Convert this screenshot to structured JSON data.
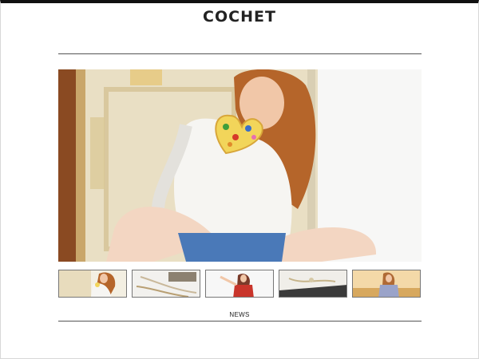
{
  "brand": {
    "logo_text": "COCHET"
  },
  "hero": {
    "image": "woman-holding-heart-cookie-photo"
  },
  "thumbnails": [
    {
      "image": "woman-holding-heart-cookie-thumbnail"
    },
    {
      "image": "jewelry-accessories-thumbnail"
    },
    {
      "image": "woman-red-top-thumbnail"
    },
    {
      "image": "necklaces-on-table-thumbnail"
    },
    {
      "image": "woman-sunset-thumbnail"
    }
  ],
  "footer": {
    "news_label": "NEWS"
  }
}
